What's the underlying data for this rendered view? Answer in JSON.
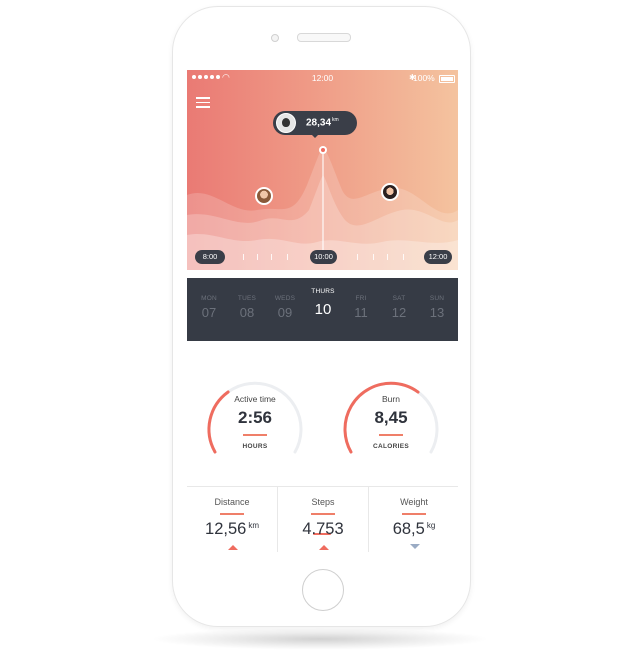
{
  "status_bar": {
    "time": "12:00",
    "battery": "100%"
  },
  "chart_bubble": {
    "value": "28,34",
    "unit": "km"
  },
  "timeline": {
    "start": "8:00",
    "current": "10:00",
    "end": "12:00"
  },
  "days": [
    {
      "name": "MON",
      "num": "07",
      "active": false
    },
    {
      "name": "TUES",
      "num": "08",
      "active": false
    },
    {
      "name": "WEDS",
      "num": "09",
      "active": false
    },
    {
      "name": "THURS",
      "num": "10",
      "active": true
    },
    {
      "name": "FRI",
      "num": "11",
      "active": false
    },
    {
      "name": "SAT",
      "num": "12",
      "active": false
    },
    {
      "name": "SUN",
      "num": "13",
      "active": false
    }
  ],
  "rings": {
    "active": {
      "label": "Active time",
      "value": "2:56",
      "unit": "HOURS",
      "progress": 0.35
    },
    "burn": {
      "label": "Burn",
      "value": "8,45",
      "unit": "CALORIES",
      "progress": 0.65
    }
  },
  "metrics": {
    "distance": {
      "label": "Distance",
      "value": "12,56",
      "unit": "km",
      "trend": "up"
    },
    "steps": {
      "label": "Steps",
      "value": "4.753",
      "unit": "",
      "trend": "up"
    },
    "weight": {
      "label": "Weight",
      "value": "68,5",
      "unit": "kg",
      "trend": "down"
    }
  },
  "colors": {
    "accent": "#ef6c5f",
    "dark": "#363b45",
    "down": "#9aabc4"
  },
  "icons": {
    "menu": "hamburger-icon",
    "wifi": "wifi-icon",
    "bluetooth": "bluetooth-icon"
  }
}
